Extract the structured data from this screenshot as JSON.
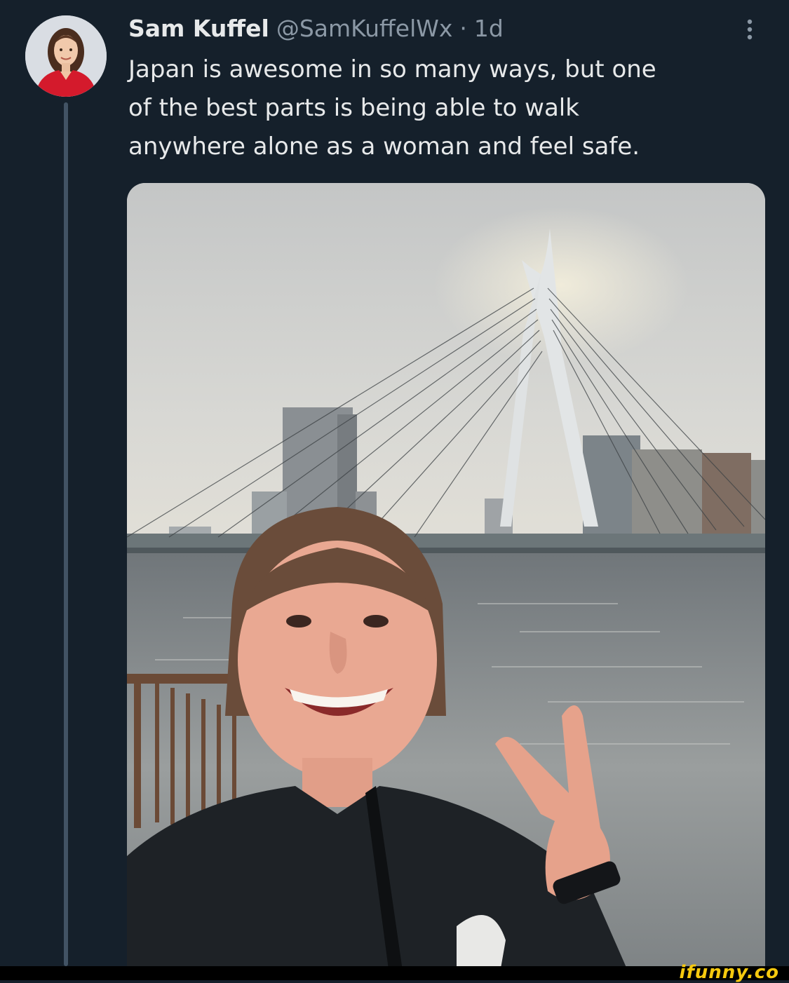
{
  "tweet": {
    "author_name": "Sam Kuffel",
    "author_handle": "@SamKuffelWx",
    "separator": "·",
    "timestamp": "1d",
    "text_lines": [
      "Japan is awesome in so many ways, but one",
      "of the best parts is being able to walk",
      "anywhere alone as a woman and feel safe."
    ]
  },
  "icons": {
    "more": "more-vertical-icon"
  },
  "watermark": "ifunny.co",
  "colors": {
    "background": "#15202b",
    "primary_text": "#e7e9ea",
    "secondary_text": "#8b98a5",
    "thread_line": "#425364",
    "watermark": "#f6c90e"
  }
}
